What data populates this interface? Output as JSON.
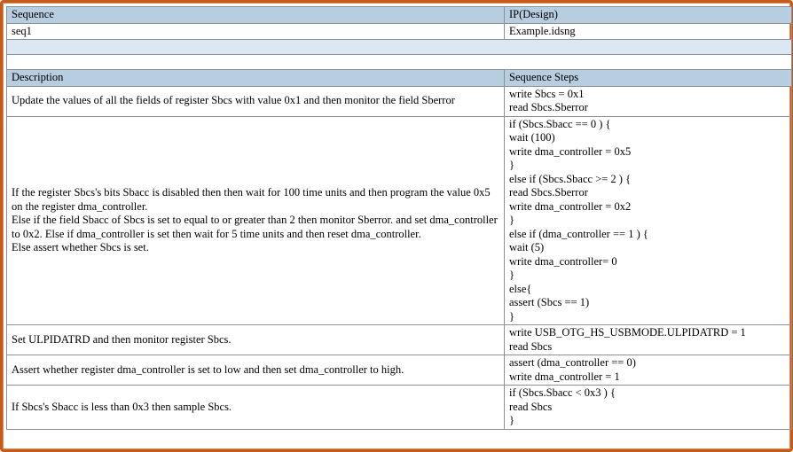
{
  "header": {
    "sequence_label": "Sequence",
    "ip_label": "IP(Design)",
    "sequence_value": "seq1",
    "ip_value": "Example.idsng"
  },
  "table": {
    "columns": [
      "Description",
      "Sequence Steps"
    ],
    "rows": [
      {
        "description": [
          "Update the values of all the fields of register Sbcs with value 0x1 and then monitor the field Sberror"
        ],
        "steps": [
          "write Sbcs = 0x1",
          "read Sbcs.Sberror"
        ]
      },
      {
        "description": [
          "If the register Sbcs's bits Sbacc is disabled then then wait for 100 time units and then program the value 0x5 on the register dma_controller.",
          "Else if the field Sbacc of Sbcs is set to equal to or greater than 2 then monitor Sberror. and set dma_controller to 0x2. Else if dma_controller is set then wait for 5 time units and then reset dma_controller.",
          "Else assert whether Sbcs is set."
        ],
        "steps": [
          "if (Sbcs.Sbacc == 0 ) {",
          "wait (100)",
          "write dma_controller = 0x5",
          "}",
          "else if (Sbcs.Sbacc >= 2 ) {",
          "read Sbcs.Sberror",
          "write dma_controller = 0x2",
          "}",
          "else if (dma_controller == 1 ) {",
          "wait (5)",
          "write dma_controller= 0",
          "}",
          "else{",
          "assert (Sbcs == 1)",
          "}"
        ]
      },
      {
        "description": [
          "Set ULPIDATRD  and then monitor register Sbcs."
        ],
        "steps": [
          "write USB_OTG_HS_USBMODE.ULPIDATRD = 1",
          "read Sbcs"
        ]
      },
      {
        "description": [
          "Assert whether register dma_controller is set to low and then set dma_controller to high."
        ],
        "steps": [
          "assert (dma_controller == 0)",
          "write dma_controller = 1"
        ]
      },
      {
        "description": [
          "If Sbcs's Sbacc is less than 0x3 then sample Sbcs."
        ],
        "steps": [
          "if (Sbcs.Sbacc < 0x3 ) {",
          "read Sbcs",
          "}"
        ]
      }
    ]
  },
  "colors": {
    "frame": "#c65a1b",
    "header_fill": "#b7cde0",
    "band_fill": "#dbe7f2"
  }
}
